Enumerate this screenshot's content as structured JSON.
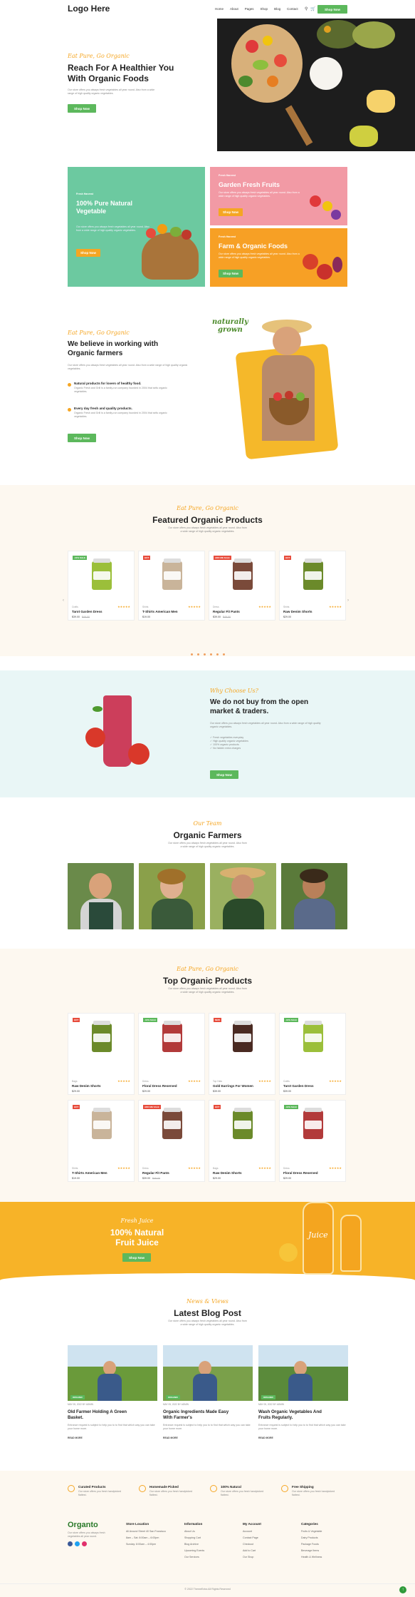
{
  "header": {
    "logo": "Logo Here",
    "nav": [
      "Home",
      "About",
      "Pages",
      "Shop",
      "Blog",
      "Contact"
    ],
    "cta": "Shop Now"
  },
  "hero": {
    "script": "Eat Pure, Go Organic",
    "title_line1": "Reach For A Healthier You",
    "title_line2": "With Organic Foods",
    "desc": "Our store offers you always fresh vegetables all year round. Also from a wide range of high quality organic vegetables.",
    "button": "Shop Now"
  },
  "promo": {
    "left_tag": "Fresh Harvest",
    "left_title_l1": "100% Pure Natural",
    "left_title_l2": "Vegetable",
    "left_desc": "Our store offers you always fresh vegetables all year round. Also from a wide range of high quality organic vegetables.",
    "left_btn": "Shop Now",
    "tr_tag": "Fresh Harvest",
    "tr_title": "Garden Fresh Fruits",
    "tr_desc": "Our store offers you always fresh vegetables all year round. Also from a wide range of high quality organic vegetables.",
    "tr_btn": "Shop Now",
    "br_tag": "Fresh Harvest",
    "br_title": "Farm & Organic Foods",
    "br_desc": "Our store offers you always fresh vegetables all year round. Also from a wide range of high quality organic vegetables.",
    "br_btn": "Shop Now"
  },
  "about": {
    "script": "Eat Pure, Go Organic",
    "title_l1": "We believe in working with",
    "title_l2": "Organic farmers",
    "desc": "Our store offers you always fresh vegetables all year round. Also from a wide range of high quality organic vegetables.",
    "f1_title": "Natural products for lovers of healthy food.",
    "f1_desc": "Organic Fresh and Grill is a family-run company founded in 2004 that sells organic vegetables.",
    "f2_title": "Every day fresh and quality products.",
    "f2_desc": "Organic Fresh and Grill is a family-run company founded in 2004 that sells organic vegetables.",
    "button": "Shop Now",
    "badge_l1": "naturally",
    "badge_l2": "grown"
  },
  "featured": {
    "script": "Eat Pure, Go Organic",
    "title": "Featured Organic Products",
    "desc_l1": "Our store offers you always fresh vegetables all year round. Also from",
    "desc_l2": "a wide range of high quality organic vegetables.",
    "products": [
      {
        "badge": "-10% SALE",
        "badge_color": "#5cb85c",
        "cat": "Crafts",
        "name": "Tarot Garden Dress",
        "price": "$39.00",
        "old": "$49.00",
        "jar": "#9bbf3a"
      },
      {
        "badge": "HOT",
        "badge_color": "#e74c3c",
        "cat": "Shirts",
        "name": "T-Shirts American Men",
        "price": "$19.00",
        "old": "",
        "jar": "#c9b49a"
      },
      {
        "badge": "ADD ME SALE",
        "badge_color": "#e74c3c",
        "cat": "Dress",
        "name": "Regular Fit Pants",
        "price": "$39.00",
        "old": "$49.00",
        "jar": "#7a4a3a"
      },
      {
        "badge": "HOT",
        "badge_color": "#e74c3c",
        "cat": "Shirts",
        "name": "Raw Denim Shorts",
        "price": "$29.00",
        "old": "",
        "jar": "#6b8a2a"
      }
    ]
  },
  "market": {
    "script": "Why Choose Us?",
    "title_l1": "We do not buy from the open",
    "title_l2": "market & traders.",
    "desc": "Our store offers you always fresh vegetables all year round. Also from a wide range of high quality organic vegetables.",
    "list": [
      "Fresh vegetables everyday",
      "High quality organic vegetables",
      "100% organic products",
      "No hidden extra charges"
    ],
    "button": "Shop Now"
  },
  "team": {
    "script": "Our Team",
    "title": "Organic Farmers",
    "desc_l1": "Our store offers you always fresh vegetables all year round. Also from",
    "desc_l2": "a wide range of high quality organic vegetables."
  },
  "top": {
    "script": "Eat Pure, Go Organic",
    "title": "Top Organic Products",
    "desc_l1": "Our store offers you always fresh vegetables all year round. Also from",
    "desc_l2": "a wide range of high quality organic vegetables.",
    "products": [
      {
        "badge": "HOT",
        "badge_color": "#e74c3c",
        "cat": "Bags",
        "name": "Raw Denim Shorts",
        "price": "$29.00",
        "old": "",
        "jar": "#6b8a2a"
      },
      {
        "badge": "-10% SALE",
        "badge_color": "#5cb85c",
        "cat": "Dress",
        "name": "Floral Dress Reserved",
        "price": "$29.00",
        "old": "",
        "jar": "#b23a3a"
      },
      {
        "badge": "NEW",
        "badge_color": "#e74c3c",
        "cat": "Top Hats",
        "name": "Gold Earrings For Women",
        "price": "$39.00",
        "old": "",
        "jar": "#4a2a22"
      },
      {
        "badge": "-10% SALE",
        "badge_color": "#5cb85c",
        "cat": "Crafts",
        "name": "Tarot Garden Dress",
        "price": "$39.00",
        "old": "",
        "jar": "#9bbf3a"
      },
      {
        "badge": "HOT",
        "badge_color": "#e74c3c",
        "cat": "Shirts",
        "name": "T-Shirts American Men",
        "price": "$19.00",
        "old": "",
        "jar": "#c9b49a"
      },
      {
        "badge": "ADD ME SALE",
        "badge_color": "#e74c3c",
        "cat": "Dress",
        "name": "Regular Fit Pants",
        "price": "$39.00",
        "old": "$49.00",
        "jar": "#7a4a3a"
      },
      {
        "badge": "HOT",
        "badge_color": "#e74c3c",
        "cat": "Bags",
        "name": "Raw Denim Shorts",
        "price": "$29.00",
        "old": "",
        "jar": "#6b8a2a"
      },
      {
        "badge": "-10% SALE",
        "badge_color": "#5cb85c",
        "cat": "Dress",
        "name": "Floral Dress Reserved",
        "price": "$29.00",
        "old": "",
        "jar": "#b23a3a"
      }
    ]
  },
  "juice": {
    "script": "Fresh Juice",
    "title_l1": "100% Natural",
    "title_l2": "Fruit Juice",
    "button": "Shop Now",
    "bottle_label": "Juice"
  },
  "blog": {
    "script": "News & Views",
    "title": "Latest Blog Post",
    "desc_l1": "Our store offers you always fresh vegetables all year round. Also from",
    "desc_l2": "a wide range of high quality organic vegetables.",
    "posts": [
      {
        "tag": "ORGANIC",
        "date": "MAY 05, 2022",
        "by": "BY ADMIN",
        "title_l1": "Old Farmer Holding A Green",
        "title_l2": "Basket.",
        "desc": "Entrance request is subject to help you to to find that which way you can take your home more.",
        "more": "READ MORE"
      },
      {
        "tag": "ORGANIC",
        "date": "MAY 05, 2022",
        "by": "BY ADMIN",
        "title_l1": "Organic Ingredients Made Easy",
        "title_l2": "With Farmer's",
        "desc": "Entrance request is subject to help you to to find that which way you can take your home more.",
        "more": "READ MORE"
      },
      {
        "tag": "ORGANIC",
        "date": "MAY 05, 2022",
        "by": "BY ADMIN",
        "title_l1": "Wash Organic Vegetables And",
        "title_l2": "Fruits Regularly.",
        "desc": "Entrance request is subject to help you to to find that which way you can take your home more.",
        "more": "READ MORE"
      }
    ]
  },
  "features": [
    {
      "title": "Curated Products",
      "desc": "Our store offers you fresh handpicked flattest."
    },
    {
      "title": "Homemade Picked",
      "desc": "Our store offers you fresh handpicked flattest."
    },
    {
      "title": "100% Natural",
      "desc": "Our store offers you fresh handpicked flattest."
    },
    {
      "title": "Free Shipping",
      "desc": "Our store offers you fresh handpicked flattest."
    }
  ],
  "footer": {
    "brand": "Organto",
    "brand_desc": "Our store offers you always fresh vegetables all year round.",
    "cols": [
      {
        "title": "Store Location",
        "items": [
          "All Around Street 40 San Francisco",
          "8am – Sat: 8:00am – 6:00pm",
          "Sunday: 8:00am – 4:00pm"
        ]
      },
      {
        "title": "Information",
        "items": [
          "About Us",
          "Shopping Cart",
          "Blog Archive",
          "Upcoming Events",
          "Our Services"
        ]
      },
      {
        "title": "My Account",
        "items": [
          "Account",
          "Contact Page",
          "Checkout",
          "Add to Cart",
          "Our Shop"
        ]
      },
      {
        "title": "Categories",
        "items": [
          "Fruits & Vegetable",
          "Dairy Products",
          "Package Foods",
          "Beverage Items",
          "Health & Wellness"
        ]
      }
    ],
    "copyright": "© 2022 ThemeExtra All Rights Reserved",
    "top_btn": "↑"
  },
  "colors": {
    "green": "#5cb85c",
    "orange": "#f5a623",
    "mint": "#6cc9a0",
    "pink": "#f29aa5",
    "cream": "#fdf8f0",
    "teal": "#e9f6f6",
    "yellow": "#f7b328"
  }
}
